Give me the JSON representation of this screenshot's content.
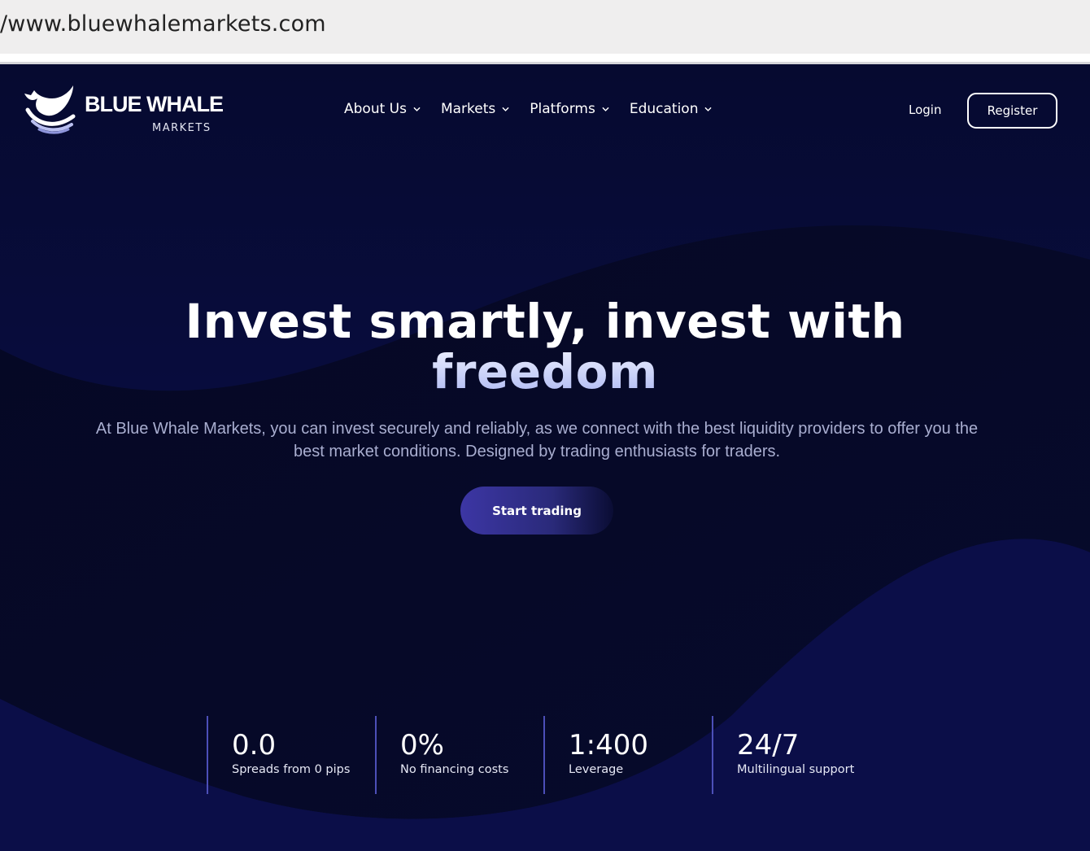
{
  "browser": {
    "url": "/www.bluewhalemarkets.com"
  },
  "brand": {
    "name": "BLUE WHALE",
    "sub": "MARKETS"
  },
  "nav": {
    "items": [
      {
        "label": "About Us"
      },
      {
        "label": "Markets"
      },
      {
        "label": "Platforms"
      },
      {
        "label": "Education"
      }
    ],
    "login": "Login",
    "register": "Register"
  },
  "hero": {
    "title_main": "Invest smartly, invest with",
    "title_accent": "freedom",
    "subtitle": "At Blue Whale Markets, you can invest securely and reliably, as we connect with the best liquidity providers to offer you the best market conditions. Designed by trading enthusiasts for traders.",
    "cta": "Start trading"
  },
  "stats": [
    {
      "value": "0.0",
      "label": "Spreads from 0 pips"
    },
    {
      "value": "0%",
      "label": "No financing costs"
    },
    {
      "value": "1:400",
      "label": "Leverage"
    },
    {
      "value": "24/7",
      "label": "Multilingual support"
    }
  ],
  "colors": {
    "background": "#0b0f3f",
    "accent": "#4c4fb8",
    "cta": "#3c36a4"
  }
}
